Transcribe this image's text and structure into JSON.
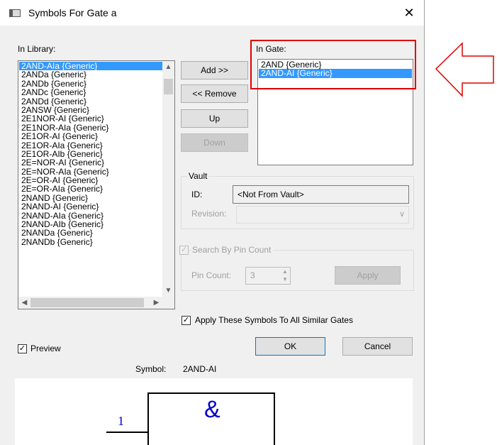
{
  "dialog": {
    "title": "Symbols For Gate a"
  },
  "library": {
    "label": "In Library:",
    "items": [
      "2AND-AIa {Generic}",
      "2ANDa {Generic}",
      "2ANDb {Generic}",
      "2ANDc {Generic}",
      "2ANDd {Generic}",
      "2ANSW {Generic}",
      "2E1NOR-AI {Generic}",
      "2E1NOR-AIa {Generic}",
      "2E1OR-AI {Generic}",
      "2E1OR-AIa {Generic}",
      "2E1OR-AIb {Generic}",
      "2E=NOR-AI {Generic}",
      "2E=NOR-AIa {Generic}",
      "2E=OR-AI {Generic}",
      "2E=OR-AIa {Generic}",
      "2NAND {Generic}",
      "2NAND-AI {Generic}",
      "2NAND-AIa {Generic}",
      "2NAND-AIb {Generic}",
      "2NANDa {Generic}",
      "2NANDb {Generic}"
    ],
    "selected": 0
  },
  "gate": {
    "label": "In Gate:",
    "items": [
      "2AND {Generic}",
      "2AND-AI {Generic}"
    ],
    "selected": 1
  },
  "buttons": {
    "add": "Add >>",
    "remove": "<< Remove",
    "up": "Up",
    "down": "Down",
    "ok": "OK",
    "cancel": "Cancel",
    "apply": "Apply"
  },
  "vault": {
    "label": "Vault",
    "id_label": "ID:",
    "id_value": "<Not From Vault>",
    "revision_label": "Revision:"
  },
  "search": {
    "label": "Search By Pin Count",
    "checked": true,
    "enabled": false,
    "pin_count_label": "Pin Count:",
    "pin_count_value": "3"
  },
  "apply_all": {
    "label": "Apply These Symbols To All Similar Gates",
    "checked": true
  },
  "preview": {
    "label": "Preview",
    "checked": true
  },
  "symbol": {
    "label": "Symbol:",
    "value": "2AND-AI",
    "pin_number": "1",
    "gate_symbol": "&"
  },
  "colors": {
    "selection": "#3399ff",
    "highlight": "#e00000",
    "symbol_text": "#0000cc"
  }
}
